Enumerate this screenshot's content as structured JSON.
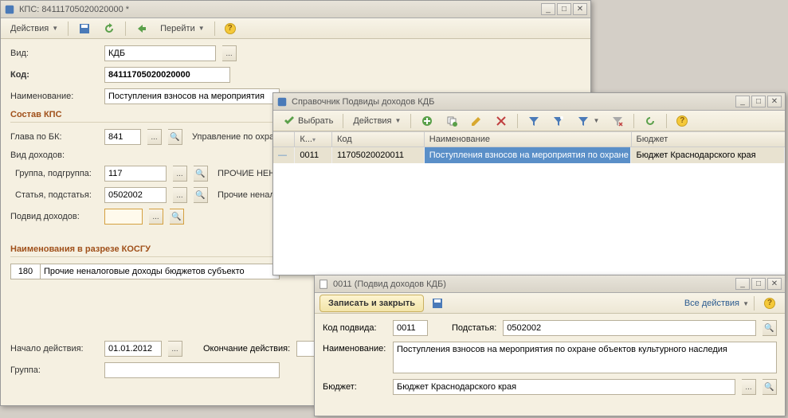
{
  "win1": {
    "title": "КПС: 84111705020020000 *",
    "toolbar": {
      "actions": "Действия",
      "goto": "Перейти"
    },
    "vid_label": "Вид:",
    "vid_value": "КДБ",
    "kod_label": "Код:",
    "kod_value": "84111705020020000",
    "naim_label": "Наименование:",
    "naim_value": "Поступления взносов на мероприятия",
    "section_sostav": "Состав КПС",
    "glava_label": "Глава по БК:",
    "glava_value": "841",
    "glava_desc": "Управление по охране",
    "viddoh_label": "Вид доходов:",
    "gruppa_label": "Группа, подгруппа:",
    "gruppa_value": "117",
    "gruppa_desc": "ПРОЧИЕ НЕНАЛО",
    "statya_label": "Статья, подстатья:",
    "statya_value": "0502002",
    "statya_desc": "Прочие неналогов",
    "podvid_label": "Подвид доходов:",
    "podvid_value": "",
    "section_kosgu": "Наименования в разрезе КОСГУ",
    "kosgu_code": "180",
    "kosgu_text": "Прочие неналоговые доходы бюджетов субъекто",
    "nachalo_label": "Начало действия:",
    "nachalo_value": "01.01.2012",
    "okonch_label": "Окончание действия:",
    "okonch_value": "",
    "gruppa2_label": "Группа:",
    "gruppa2_value": ""
  },
  "win2": {
    "title": "Справочник Подвиды доходов КДБ",
    "toolbar": {
      "select": "Выбрать",
      "actions": "Действия"
    },
    "col_k": "К...",
    "col_kod": "Код",
    "col_naim": "Наименование",
    "col_budget": "Бюджет",
    "row_k": "0011",
    "row_kod": "11705020020011",
    "row_naim": "Поступления взносов на мероприятия по охране ...",
    "row_budget": "Бюджет Краснодарского края"
  },
  "win3": {
    "title": "0011 (Подвид доходов КДБ)",
    "save_close": "Записать и закрыть",
    "all_actions": "Все действия",
    "kodpodvid_label": "Код подвида:",
    "kodpodvid_value": "0011",
    "podstatya_label": "Подстатья:",
    "podstatya_value": "0502002",
    "naim_label": "Наименование:",
    "naim_value": "Поступления взносов на мероприятия по охране объектов культурного наследия",
    "budget_label": "Бюджет:",
    "budget_value": "Бюджет Краснодарского края"
  }
}
